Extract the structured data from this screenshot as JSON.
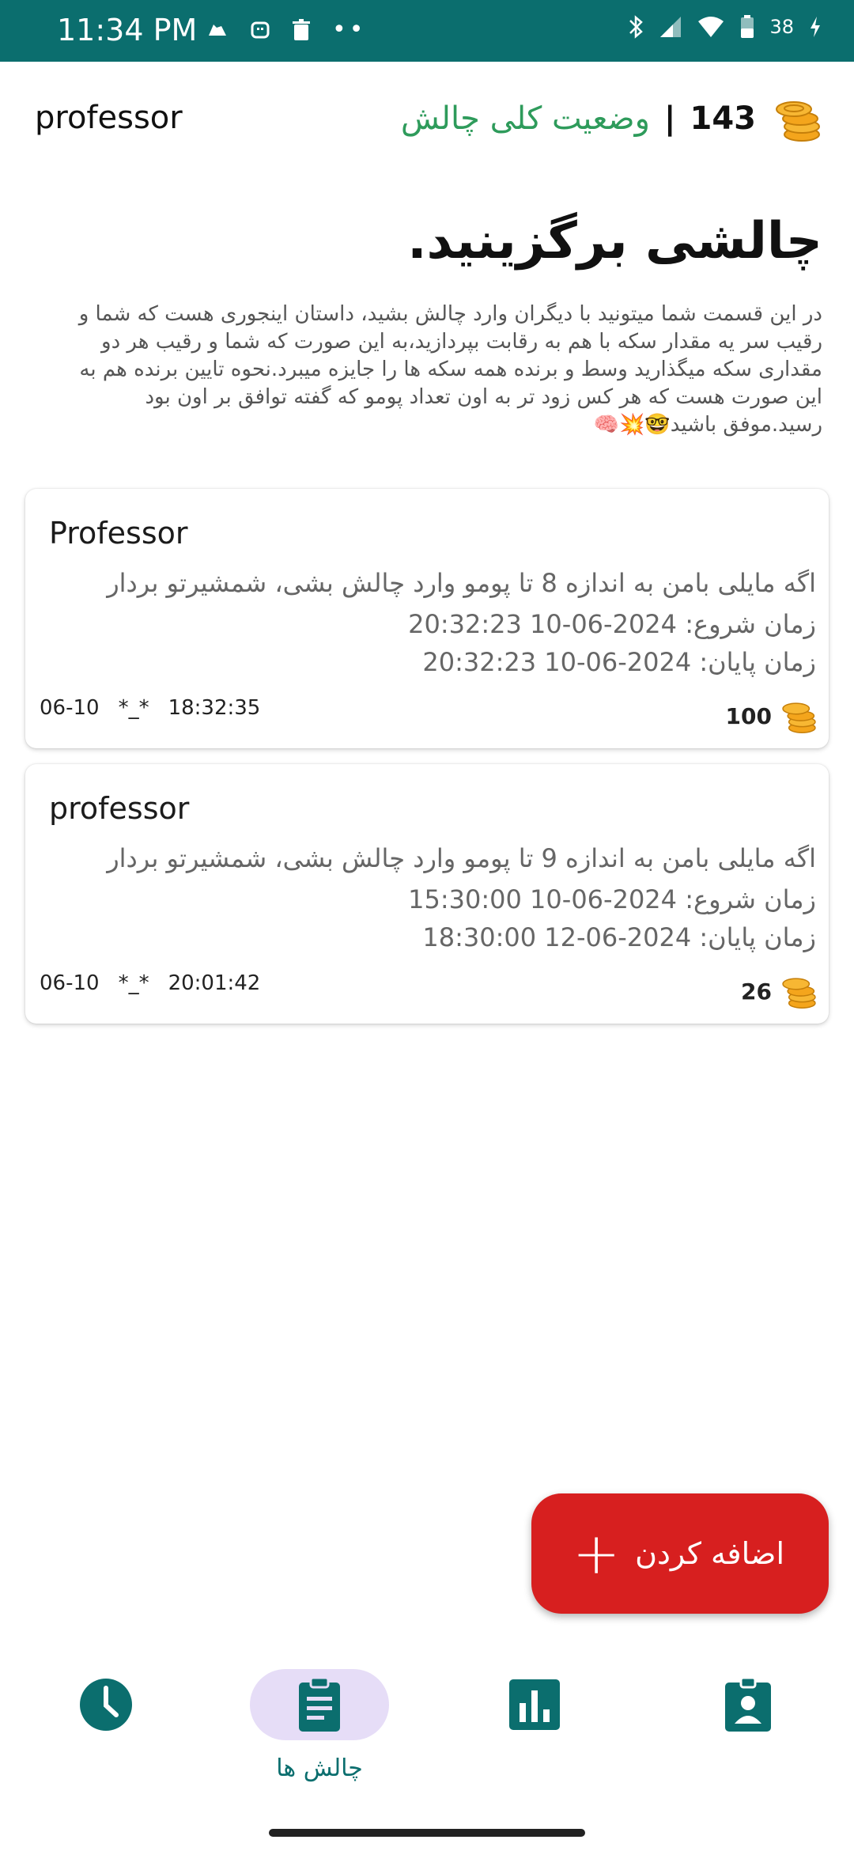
{
  "status_bar": {
    "time": "11:34 PM",
    "battery": "38",
    "dots": "••"
  },
  "header": {
    "username": "professor",
    "coins": "143",
    "separator": "|",
    "overall_status": "وضعیت کلی چالش"
  },
  "page": {
    "title": "چالشی برگزینید.",
    "description": "در این قسمت شما میتونید با دیگران وارد چالش بشید، داستان اینجوری هست که شما و رقیب سر یه مقدار سکه با هم به رقابت بپردازید،به این صورت که شما و رقیب هر دو مقداری سکه میگذارید وسط و برنده همه سکه ها را جایزه میبرد.نحوه تایین برنده هم به این صورت هست که هر کس زود تر به اون تعداد پومو که گفته توافق بر اون بود رسید.موفق باشید🤓💥🧠"
  },
  "challenges": [
    {
      "user": "Professor",
      "text": "اگه مایلی بامن به اندازه 8 تا پومو وارد چالش بشی، شمشیرتو بردار",
      "start": "زمان شروع: 2024-06-10 20:32:23",
      "end": "زمان پایان: 2024-06-10 20:32:23",
      "date": "06-10",
      "mark": "*_*",
      "time": "18:32:35",
      "amount": "100"
    },
    {
      "user": "professor",
      "text": "اگه مایلی بامن به اندازه 9 تا پومو وارد چالش بشی، شمشیرتو بردار",
      "start": "زمان شروع: 2024-06-10 15:30:00",
      "end": "زمان پایان: 2024-06-12 18:30:00",
      "date": "06-10",
      "mark": "*_*",
      "time": "20:01:42",
      "amount": "26"
    }
  ],
  "fab": {
    "label": "اضافه کردن",
    "plus": "+"
  },
  "bottom_nav": {
    "active_label": "چالش ها"
  },
  "colors": {
    "primary": "#0b6e6e",
    "accent_green": "#2e9b5b",
    "fab_red": "#d71f1f",
    "active_pill": "#e6ddf7"
  }
}
